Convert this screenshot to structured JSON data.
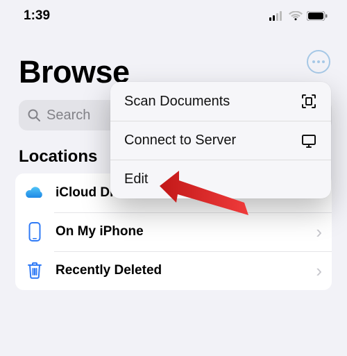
{
  "status": {
    "time": "1:39"
  },
  "more_button": {
    "name": "more"
  },
  "title": "Browse",
  "search": {
    "placeholder": "Search"
  },
  "section_locations": "Locations",
  "locations": [
    {
      "label": "iCloud Drive"
    },
    {
      "label": "On My iPhone"
    },
    {
      "label": "Recently Deleted"
    }
  ],
  "popover": {
    "items": [
      {
        "label": "Scan Documents"
      },
      {
        "label": "Connect to Server"
      },
      {
        "label": "Edit"
      }
    ]
  }
}
